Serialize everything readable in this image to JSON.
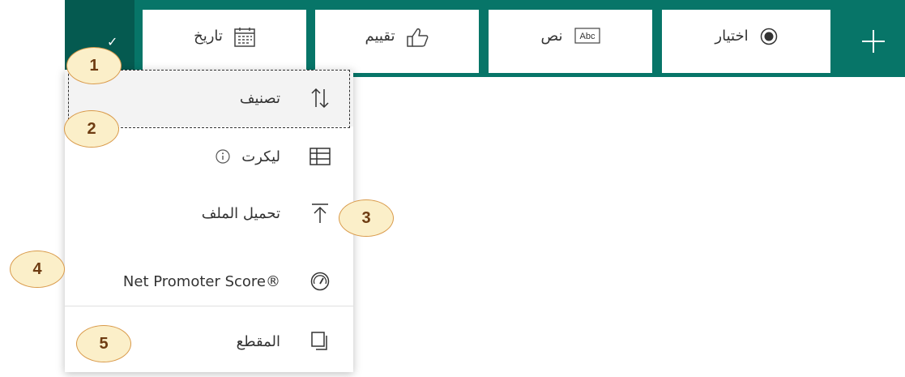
{
  "toolbar": {
    "accent": "#077568",
    "buttons": [
      {
        "label": "تاريخ",
        "icon": "calendar-icon"
      },
      {
        "label": "تقييم",
        "icon": "thumbs-up-icon"
      },
      {
        "label": "نص",
        "icon": "abc-text-icon"
      },
      {
        "label": "اختيار",
        "icon": "radio-icon"
      }
    ],
    "add_icon": "plus-icon",
    "more_icon": "chevron-icon"
  },
  "menu": {
    "items": [
      {
        "label": "تصنيف",
        "icon": "sort-arrows-icon"
      },
      {
        "label": "ليكرت",
        "icon": "grid-table-icon",
        "info_icon": "info-icon"
      },
      {
        "label": "تحميل الملف",
        "icon": "upload-icon"
      },
      {
        "label": "Net Promoter Score®",
        "icon": "gauge-icon"
      },
      {
        "label": "المقطع",
        "icon": "section-copy-icon"
      }
    ]
  },
  "callouts": [
    "1",
    "2",
    "3",
    "4",
    "5"
  ]
}
